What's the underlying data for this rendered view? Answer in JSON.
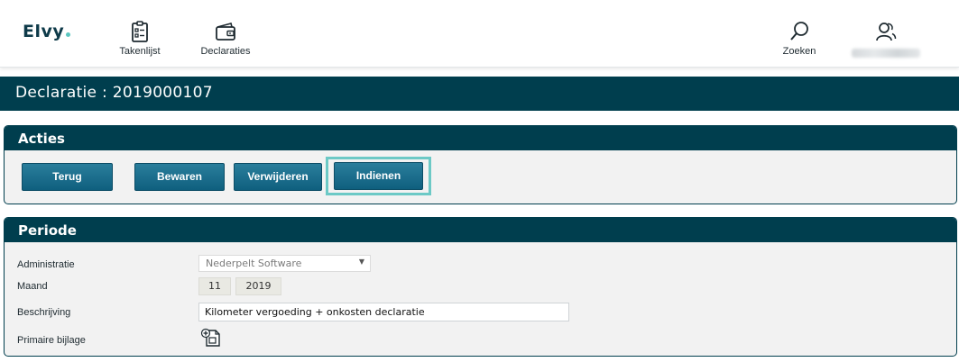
{
  "app": {
    "logo_text": "Elvy",
    "nav": {
      "takenlijst_label": "Takenlijst",
      "declaraties_label": "Declaraties",
      "zoeken_label": "Zoeken"
    },
    "icons": {
      "takenlijst": "checklist-icon",
      "declaraties": "wallet-icon",
      "zoeken": "search-icon",
      "user": "users-icon"
    }
  },
  "page": {
    "title": "Declaratie : 2019000107"
  },
  "acties": {
    "header": "Acties",
    "buttons": {
      "terug": "Terug",
      "bewaren": "Bewaren",
      "verwijderen": "Verwijderen",
      "indienen": "Indienen"
    }
  },
  "periode": {
    "header": "Periode",
    "fields": {
      "administratie_label": "Administratie",
      "administratie_value": "Nederpelt Software",
      "maand_label": "Maand",
      "maand_value": "11",
      "jaar_value": "2019",
      "beschrijving_label": "Beschrijving",
      "beschrijving_value": "Kilometer vergoeding + onkosten declaratie",
      "primaire_bijlage_label": "Primaire bijlage"
    },
    "attachment_icon": "add-attachment-icon"
  },
  "colors": {
    "primary_dark": "#003e4e",
    "button": "#1a6f8e",
    "highlight": "#6cc9c6",
    "panel_bg": "#f2f2f2"
  }
}
